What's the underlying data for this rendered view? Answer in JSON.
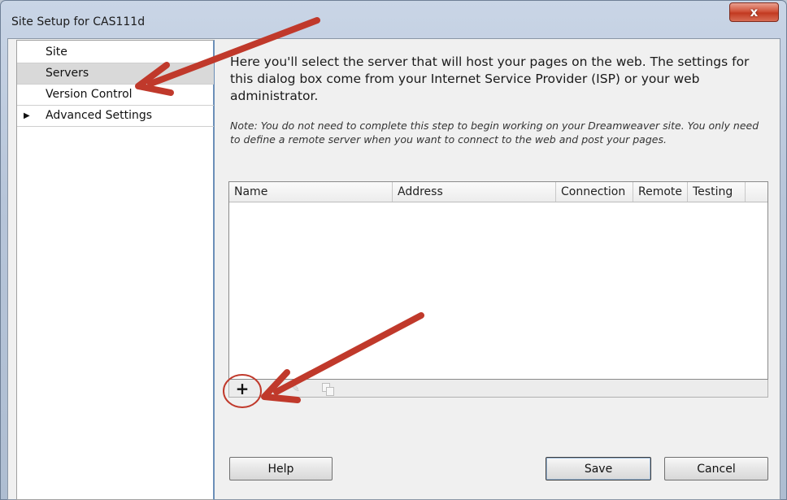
{
  "window": {
    "title": "Site Setup for CAS111d",
    "close_glyph": "x"
  },
  "sidebar": {
    "items": [
      {
        "label": "Site",
        "selected": false,
        "expandable": false
      },
      {
        "label": "Servers",
        "selected": true,
        "expandable": false
      },
      {
        "label": "Version Control",
        "selected": false,
        "expandable": false
      },
      {
        "label": "Advanced Settings",
        "selected": false,
        "expandable": true
      }
    ],
    "expand_glyph": "▶"
  },
  "main": {
    "description": "Here you'll select the server that will host your pages on the web. The settings for this dialog box come from your Internet Service Provider (ISP) or your web administrator.",
    "note": "Note: You do not need to complete this step to begin working on your Dreamweaver site. You only need to define a remote server when you want to connect to the web and post your pages."
  },
  "servers_table": {
    "columns": [
      "Name",
      "Address",
      "Connection",
      "Remote",
      "Testing"
    ],
    "rows": []
  },
  "table_toolbar": {
    "add_icon": "plus-icon",
    "add_glyph": "+",
    "edit_icon": "pencil-icon",
    "edit_glyph": "✎",
    "duplicate_icon": "duplicate-icon"
  },
  "buttons": {
    "help": "Help",
    "save": "Save",
    "cancel": "Cancel"
  },
  "annotations": {
    "color": "#c0392b"
  }
}
